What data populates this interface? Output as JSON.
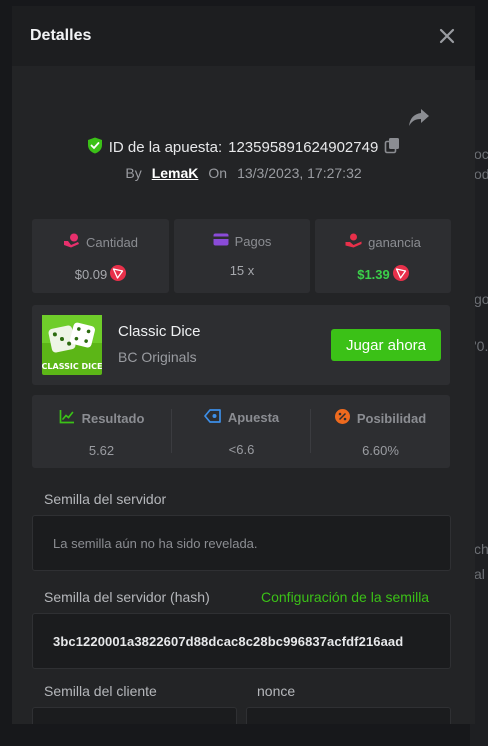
{
  "modal": {
    "title": "Detalles"
  },
  "bet": {
    "id_label": "ID de la apuesta:",
    "id_value": "123595891624902749",
    "by_label": "By",
    "user": "LemaK",
    "on_label": "On",
    "datetime": "13/3/2023, 17:27:32"
  },
  "stats": [
    {
      "label": "Cantidad",
      "value": "$0.09",
      "icon": "amount-icon"
    },
    {
      "label": "Pagos",
      "value": "15 x",
      "icon": "payout-icon"
    },
    {
      "label": "ganancia",
      "value": "$1.39",
      "icon": "profit-icon"
    }
  ],
  "game": {
    "thumb_text": "CLASSIC DICE",
    "name": "Classic Dice",
    "provider": "BC Originals",
    "play_label": "Jugar ahora"
  },
  "results": [
    {
      "label": "Resultado",
      "value": "5.62",
      "icon": "result-icon"
    },
    {
      "label": "Apuesta",
      "value": "<6.6",
      "icon": "bet-tag-icon"
    },
    {
      "label": "Posibilidad",
      "value": "6.60%",
      "icon": "chance-icon"
    }
  ],
  "seeds": {
    "server_label": "Semilla del servidor",
    "server_value": "La semilla aún no ha sido revelada.",
    "server_hash_label": "Semilla del servidor (hash)",
    "config_link": "Configuración de la semilla",
    "server_hash_value": "3bc1220001a3822607d88dcac8c28bc996837acfdf216aad",
    "client_label": "Semilla del cliente",
    "nonce_label": "nonce"
  },
  "background": {
    "ghost_texts": [
      "oc",
      "od",
      "go",
      "'0.",
      "ch",
      "al"
    ]
  },
  "colors": {
    "accent_green": "#3bc117",
    "profit_green": "#3bd14a",
    "trx_red": "#e8304a"
  }
}
